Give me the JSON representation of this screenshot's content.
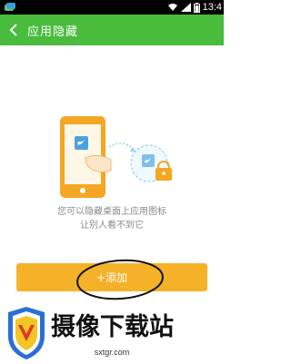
{
  "status_bar": {
    "time": "13:4"
  },
  "header": {
    "title": "应用隐藏"
  },
  "main": {
    "description_line1": "您可以隐藏桌面上应用图标",
    "description_line2": "让别人看不到它",
    "add_button_label": "+添加"
  },
  "watermark": {
    "name": "摄像下载站",
    "url": "sxtgr.com"
  },
  "colors": {
    "header_green": "#49bc3c",
    "button_yellow": "#f5b229",
    "phone_orange": "#f5a623",
    "app_blue": "#4aa3df"
  }
}
